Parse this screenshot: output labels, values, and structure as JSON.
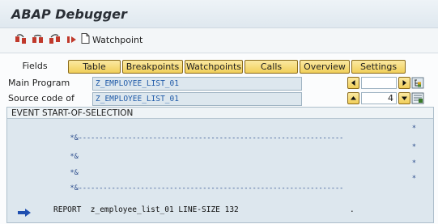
{
  "window": {
    "title": "ABAP Debugger"
  },
  "toolbar": {
    "icons": [
      "step-into-icon",
      "step-over-icon",
      "return-icon",
      "continue-icon"
    ],
    "watchpoint_label": "Watchpoint"
  },
  "tabs": [
    {
      "label": "Fields",
      "active": true
    },
    {
      "label": "Table"
    },
    {
      "label": "Breakpoints"
    },
    {
      "label": "Watchpoints"
    },
    {
      "label": "Calls"
    },
    {
      "label": "Overview"
    },
    {
      "label": "Settings"
    }
  ],
  "main_program": {
    "label": "Main Program",
    "value": "Z_EMPLOYEE_LIST_01",
    "line_value": ""
  },
  "source_code_of": {
    "label": "Source code of",
    "value": "Z_EMPLOYEE_LIST_01",
    "line_value": "4"
  },
  "source": {
    "header": "EVENT START-OF-SELECTION",
    "lines": [
      {
        "text": "*&----------------------------------------------------------------",
        "end": "*"
      },
      {
        "text": "*&",
        "end": "*"
      },
      {
        "text": "*&",
        "end": "*"
      },
      {
        "text": "*&----------------------------------------------------------------",
        "end": "*"
      }
    ],
    "current_line": "REPORT  z_employee_list_01 LINE-SIZE 132",
    "current_line_tail": "."
  },
  "colors": {
    "tab_fill": "#f1cf5a",
    "field_text": "#1f5aa8",
    "arrow": "#1f4fb0"
  }
}
